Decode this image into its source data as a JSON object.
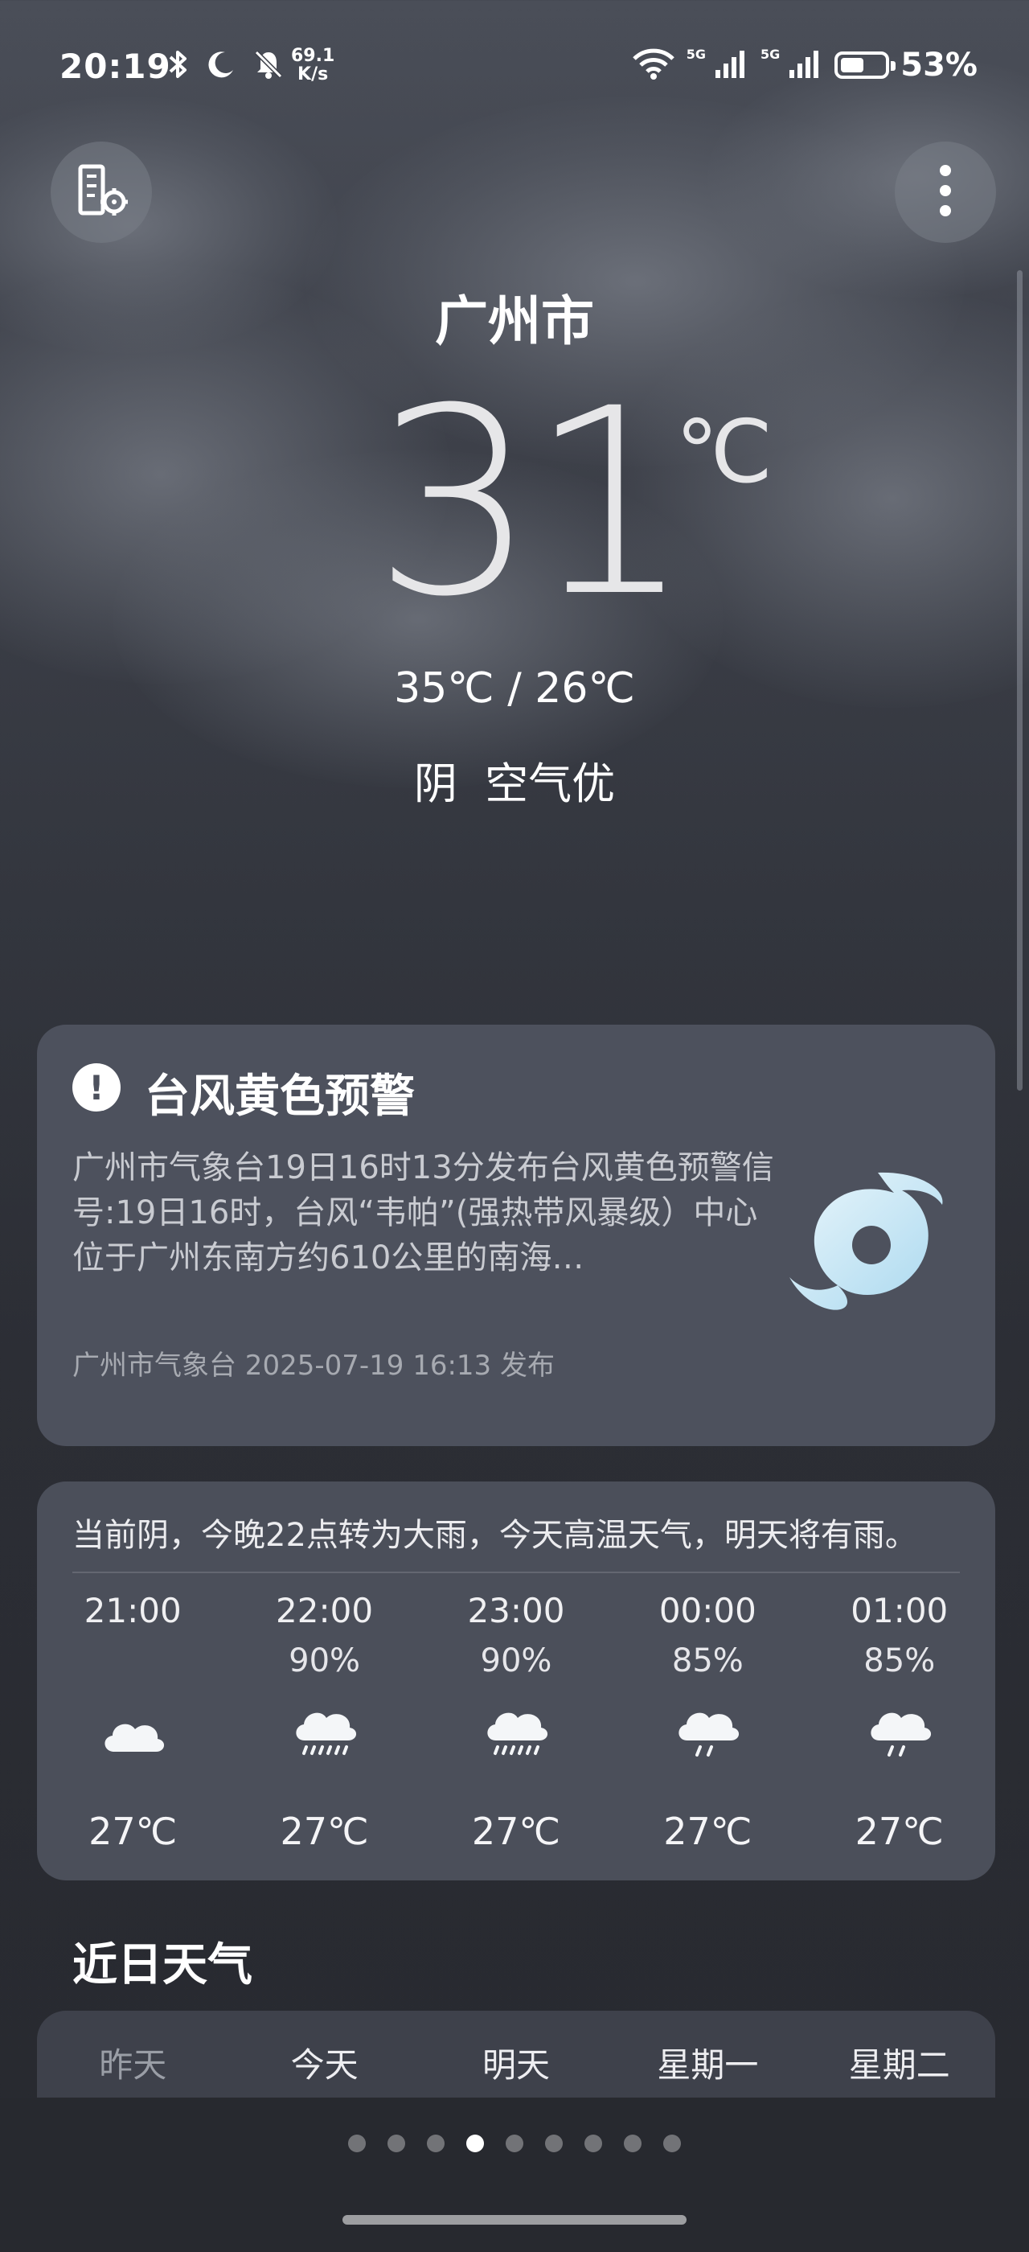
{
  "status_bar": {
    "time": "20:19",
    "net_speed_value": "69.1",
    "net_speed_unit": "K/s",
    "network_1": "5G",
    "network_2": "5G",
    "battery": "53%",
    "battery_level": 0.53
  },
  "header": {
    "city": "广州市",
    "temperature": "31",
    "unit": "℃",
    "high_low": "35℃ / 26℃",
    "condition": "阴  空气优"
  },
  "alert": {
    "title": "台风黄色预警",
    "body": "广州市气象台19日16时13分发布台风黄色预警信号:19日16时，台风“韦帕”(强热带风暴级）中心位于广州东南方约610公里的南海…",
    "meta": "广州市气象台 2025-07-19 16:13 发布",
    "icon": "typhoon-icon"
  },
  "hourly": {
    "summary": "当前阴，今晚22点转为大雨，今天高温天气，明天将有雨。",
    "items": [
      {
        "time": "21:00",
        "prob": "",
        "icon": "cloudy-icon",
        "temp": "27℃"
      },
      {
        "time": "22:00",
        "prob": "90%",
        "icon": "heavy-rain-icon",
        "temp": "27℃"
      },
      {
        "time": "23:00",
        "prob": "90%",
        "icon": "heavy-rain-icon",
        "temp": "27℃"
      },
      {
        "time": "00:00",
        "prob": "85%",
        "icon": "light-rain-icon",
        "temp": "27℃"
      },
      {
        "time": "01:00",
        "prob": "85%",
        "icon": "light-rain-icon",
        "temp": "27℃"
      }
    ]
  },
  "daily": {
    "title": "近日天气",
    "days": [
      "昨天",
      "今天",
      "明天",
      "星期一",
      "星期二"
    ]
  },
  "pager": {
    "count": 9,
    "active_index": 3
  },
  "colors": {
    "background_top": "#4a4e58",
    "background_bottom": "#27292f",
    "card": "#4d515d",
    "typhoon_accent": "#bfe3f5"
  }
}
